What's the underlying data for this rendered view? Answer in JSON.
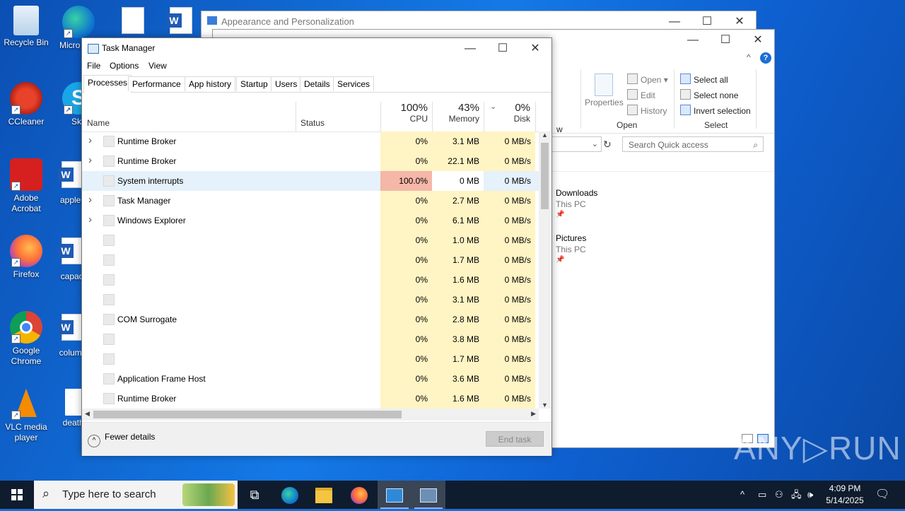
{
  "desktop": {
    "icons": [
      {
        "label": "Recycle Bin"
      },
      {
        "label": "Micro Edg"
      },
      {
        "label": "CCleaner"
      },
      {
        "label": "Sky"
      },
      {
        "label": "Adobe Acrobat"
      },
      {
        "label": "applea"
      },
      {
        "label": "Firefox"
      },
      {
        "label": "capaci"
      },
      {
        "label": "Google Chrome"
      },
      {
        "label": "columb"
      },
      {
        "label": "VLC media player"
      },
      {
        "label": "deatho"
      }
    ]
  },
  "appearance_window": {
    "title": "Appearance and Personalization"
  },
  "explorer": {
    "ribbon": {
      "properties": "Properties",
      "open": "Open",
      "edit": "Edit",
      "history": "History",
      "open_group": "Open",
      "select_all": "Select all",
      "select_none": "Select none",
      "invert_selection": "Invert selection",
      "select_group": "Select",
      "w_fragment": "w"
    },
    "search_placeholder": "Search Quick access",
    "quick_access": [
      {
        "name": "Downloads",
        "sub": "This PC"
      },
      {
        "name": "Pictures",
        "sub": "This PC"
      }
    ]
  },
  "task_manager": {
    "title": "Task Manager",
    "menu": [
      "File",
      "Options",
      "View"
    ],
    "tabs": [
      "Processes",
      "Performance",
      "App history",
      "Startup",
      "Users",
      "Details",
      "Services"
    ],
    "active_tab": "Processes",
    "columns": {
      "name": "Name",
      "status": "Status",
      "cpu_pct": "100%",
      "cpu": "CPU",
      "mem_pct": "43%",
      "memory": "Memory",
      "disk_pct": "0%",
      "disk": "Disk"
    },
    "rows": [
      {
        "name": "Runtime Broker",
        "expand": true,
        "cpu": "0%",
        "mem": "3.1 MB",
        "disk": "0 MB/s"
      },
      {
        "name": "Runtime Broker",
        "expand": true,
        "cpu": "0%",
        "mem": "22.1 MB",
        "disk": "0 MB/s"
      },
      {
        "name": "System interrupts",
        "expand": false,
        "cpu": "100.0%",
        "mem": "0 MB",
        "disk": "0 MB/s",
        "selected": true
      },
      {
        "name": "Task Manager",
        "expand": true,
        "cpu": "0%",
        "mem": "2.7 MB",
        "disk": "0 MB/s"
      },
      {
        "name": "Windows Explorer",
        "expand": true,
        "cpu": "0%",
        "mem": "6.1 MB",
        "disk": "0 MB/s"
      },
      {
        "name": "",
        "expand": false,
        "cpu": "0%",
        "mem": "1.0 MB",
        "disk": "0 MB/s"
      },
      {
        "name": "",
        "expand": false,
        "cpu": "0%",
        "mem": "1.7 MB",
        "disk": "0 MB/s"
      },
      {
        "name": "",
        "expand": false,
        "cpu": "0%",
        "mem": "1.6 MB",
        "disk": "0 MB/s"
      },
      {
        "name": "",
        "expand": false,
        "cpu": "0%",
        "mem": "3.1 MB",
        "disk": "0 MB/s"
      },
      {
        "name": "COM Surrogate",
        "expand": false,
        "cpu": "0%",
        "mem": "2.8 MB",
        "disk": "0 MB/s"
      },
      {
        "name": "",
        "expand": false,
        "cpu": "0%",
        "mem": "3.8 MB",
        "disk": "0 MB/s"
      },
      {
        "name": "",
        "expand": false,
        "cpu": "0%",
        "mem": "1.7 MB",
        "disk": "0 MB/s"
      },
      {
        "name": "Application Frame Host",
        "expand": false,
        "cpu": "0%",
        "mem": "3.6 MB",
        "disk": "0 MB/s"
      },
      {
        "name": "Runtime Broker",
        "expand": false,
        "cpu": "0%",
        "mem": "1.6 MB",
        "disk": "0 MB/s"
      }
    ],
    "fewer_details": "Fewer details",
    "end_task": "End task",
    "colors": {
      "cpu_col": "#fff4c4",
      "mem_col": "#fff4c4",
      "hot_cell": "#f4b7a8",
      "selected_row": "#e5f1fb"
    }
  },
  "taskbar": {
    "search_placeholder": "Type here to search",
    "time": "4:09 PM",
    "date": "5/14/2025"
  },
  "watermark": "ANY RUN"
}
